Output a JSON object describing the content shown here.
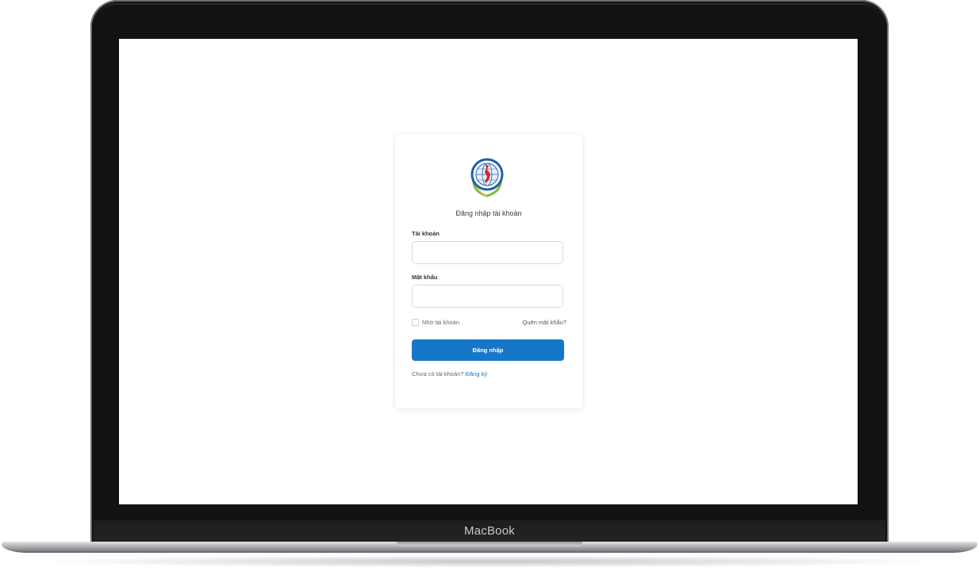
{
  "device": {
    "brand": "MacBook"
  },
  "login": {
    "title": "Đăng nhập tài khoản",
    "username": {
      "label": "Tài khoản",
      "value": "",
      "placeholder": ""
    },
    "password": {
      "label": "Mật khẩu",
      "value": "",
      "placeholder": ""
    },
    "remember_label": "Nhớ tài khoản",
    "forgot_label": "Quên mật khẩu?",
    "submit_label": "Đăng nhập",
    "no_account_text": "Chưa có tài khoản?",
    "signup_label": "Đăng ký"
  },
  "logo": {
    "icon": "globe-emblem-icon"
  },
  "colors": {
    "primary": "#1677c8",
    "logo_blue": "#1f5fae",
    "logo_red": "#d8262c",
    "logo_green": "#7fbf3f"
  }
}
